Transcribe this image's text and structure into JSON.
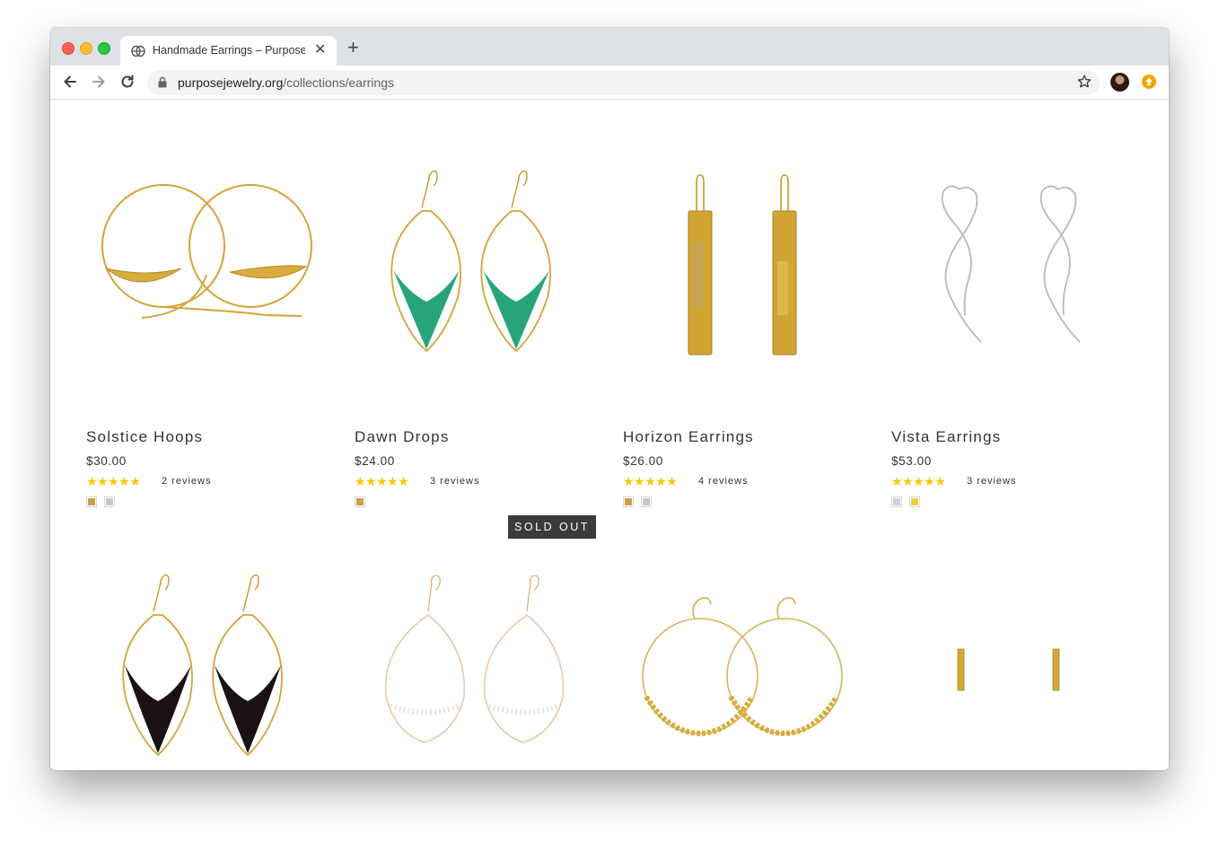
{
  "browser": {
    "tab_title": "Handmade Earrings – Purpose",
    "url_domain": "purposejewelry.org",
    "url_path": "/collections/earrings",
    "new_tab_label": "+",
    "tab_close_label": "✕"
  },
  "products": [
    {
      "name": "Solstice Hoops",
      "price": "$30.00",
      "stars": "★★★★★",
      "reviews": "2 reviews",
      "swatches": [
        "#c9a24a",
        "#c8c8c8"
      ]
    },
    {
      "name": "Dawn Drops",
      "price": "$24.00",
      "stars": "★★★★★",
      "reviews": "3 reviews",
      "swatches": [
        "#c9a24a"
      ]
    },
    {
      "name": "Horizon Earrings",
      "price": "$26.00",
      "stars": "★★★★★",
      "reviews": "4 reviews",
      "swatches": [
        "#c9a24a",
        "#c8c8c8"
      ]
    },
    {
      "name": "Vista Earrings",
      "price": "$53.00",
      "stars": "★★★★★",
      "reviews": "3 reviews",
      "swatches": [
        "#d2d2d2",
        "#e8d23a"
      ]
    }
  ],
  "sold_out_badge": "SOLD OUT",
  "colors": {
    "star": "#f9c700",
    "gold": "#d4a437",
    "emerald": "#0f9a6e",
    "onyx": "#1b1113",
    "silver": "#b9b9b9"
  }
}
